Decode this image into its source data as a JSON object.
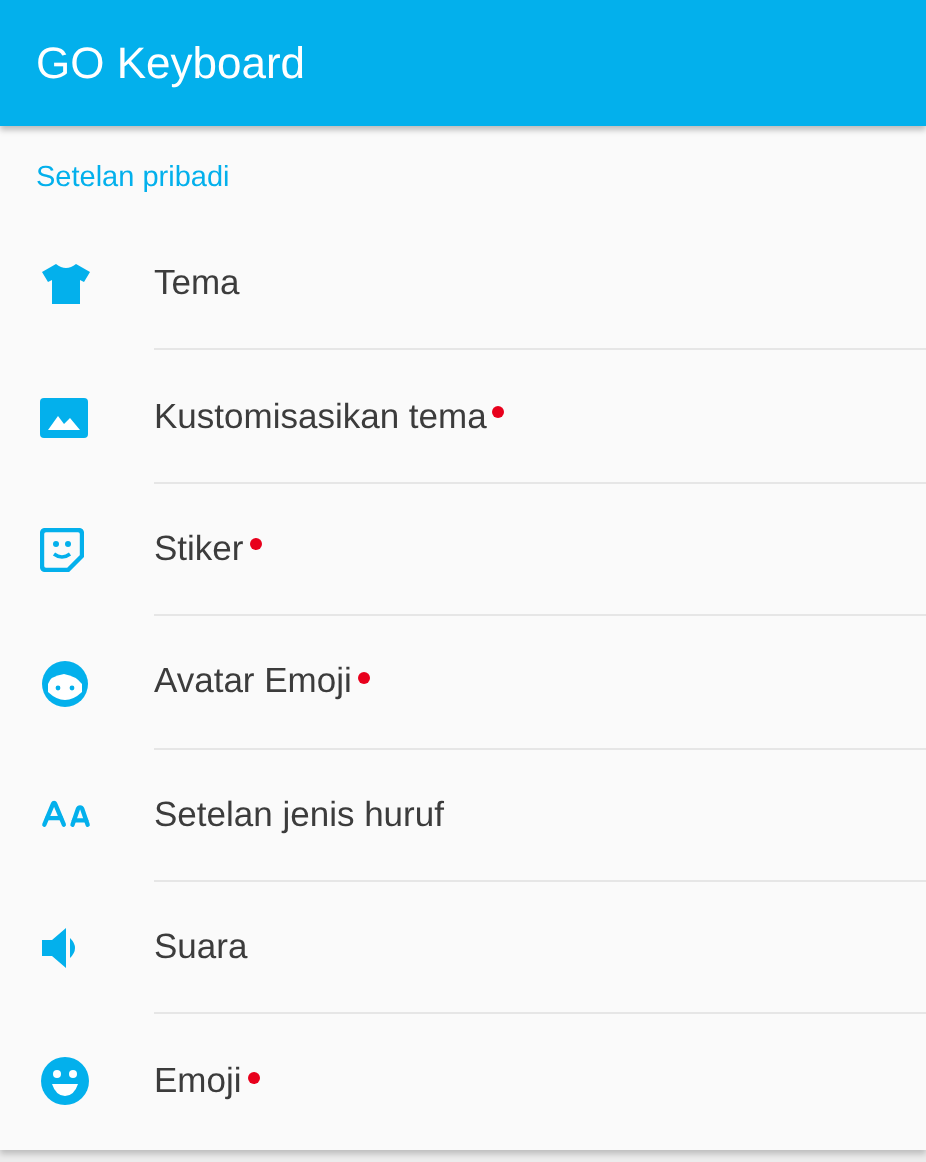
{
  "app_bar": {
    "title": "GO Keyboard"
  },
  "section": {
    "title": "Setelan pribadi"
  },
  "items": [
    {
      "kind": "shirt",
      "label": "Tema",
      "new": false
    },
    {
      "kind": "image",
      "label": "Kustomisasikan tema",
      "new": true
    },
    {
      "kind": "sticker",
      "label": "Stiker",
      "new": true
    },
    {
      "kind": "avatar",
      "label": "Avatar Emoji",
      "new": true
    },
    {
      "kind": "font",
      "label": "Setelan jenis huruf",
      "new": false
    },
    {
      "kind": "speaker",
      "label": "Suara",
      "new": false
    },
    {
      "kind": "smiley",
      "label": "Emoji",
      "new": true
    }
  ]
}
